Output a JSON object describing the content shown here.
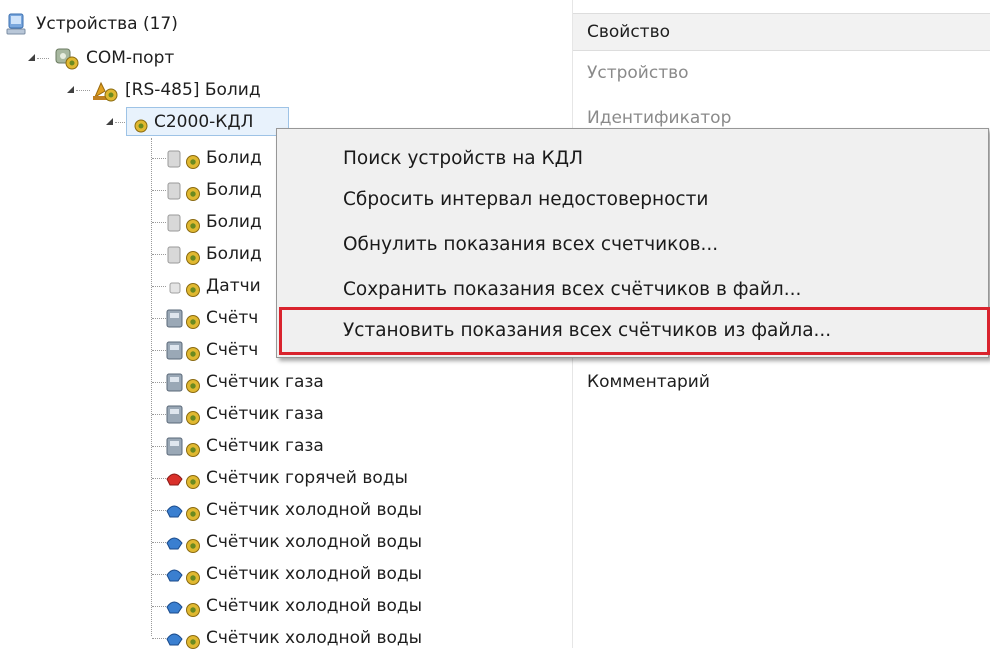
{
  "tree": {
    "root": "Устройства (17)",
    "port": "COM-порт",
    "bus": "[RS-485] Болид",
    "controller": "С2000-КДЛ",
    "children": [
      "Болид",
      "Болид",
      "Болид",
      "Болид",
      "Датчи",
      "Счётч",
      "Счётч",
      "Счётчик газа",
      "Счётчик газа",
      "Счётчик газа",
      "Счётчик горячей воды",
      "Счётчик холодной воды",
      "Счётчик холодной воды",
      "Счётчик холодной воды",
      "Счётчик холодной воды",
      "Счётчик холодной воды"
    ]
  },
  "properties": {
    "header": "Свойство",
    "rows": [
      "Устройство",
      "Идентификатор"
    ],
    "comment": "Комментарий"
  },
  "context_menu": {
    "items": [
      "Поиск устройств на КДЛ",
      "Сбросить интервал недостоверности",
      "Обнулить показания всех счетчиков...",
      "Сохранить показания всех счётчиков в файл...",
      "Установить показания всех счётчиков из файла..."
    ],
    "highlighted_index": 4,
    "highlight_color": "#d9232d"
  }
}
